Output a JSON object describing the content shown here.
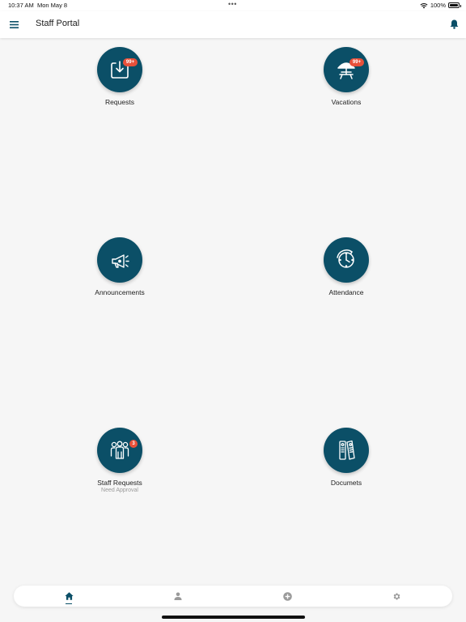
{
  "status_bar": {
    "time": "10:37 AM",
    "date": "Mon May 8",
    "dots": "•••",
    "battery": "100%",
    "icons": [
      "wifi-icon",
      "battery-icon"
    ]
  },
  "header": {
    "title": "Staff Portal",
    "left_icon": "menu-icon",
    "right_icon": "bell-icon"
  },
  "tiles": [
    {
      "label": "Requests",
      "badge": "99+",
      "icon": "inbox-download-icon"
    },
    {
      "label": "Vacations",
      "badge": "99+",
      "icon": "beach-chair-icon"
    },
    {
      "label": "Announcements",
      "badge": "",
      "icon": "megaphone-icon"
    },
    {
      "label": "Attendance",
      "badge": "",
      "icon": "clock-icon"
    },
    {
      "label": "Staff Requests",
      "sublabel": "Need Approval",
      "badge": "3",
      "icon": "staff-group-icon"
    },
    {
      "label": "Documets",
      "badge": "",
      "icon": "binders-icon"
    }
  ],
  "tab_bar": {
    "tabs": [
      {
        "name": "home",
        "icon": "home-icon",
        "active": true
      },
      {
        "name": "profile",
        "icon": "person-icon",
        "active": false
      },
      {
        "name": "add",
        "icon": "plus-circle-icon",
        "active": false
      },
      {
        "name": "settings",
        "icon": "gear-icon",
        "active": false
      }
    ]
  },
  "colors": {
    "primary": "#0b4f67",
    "badge": "#e8503a",
    "background": "#f6f6f6",
    "inactive_icon": "#9a9a9a"
  }
}
